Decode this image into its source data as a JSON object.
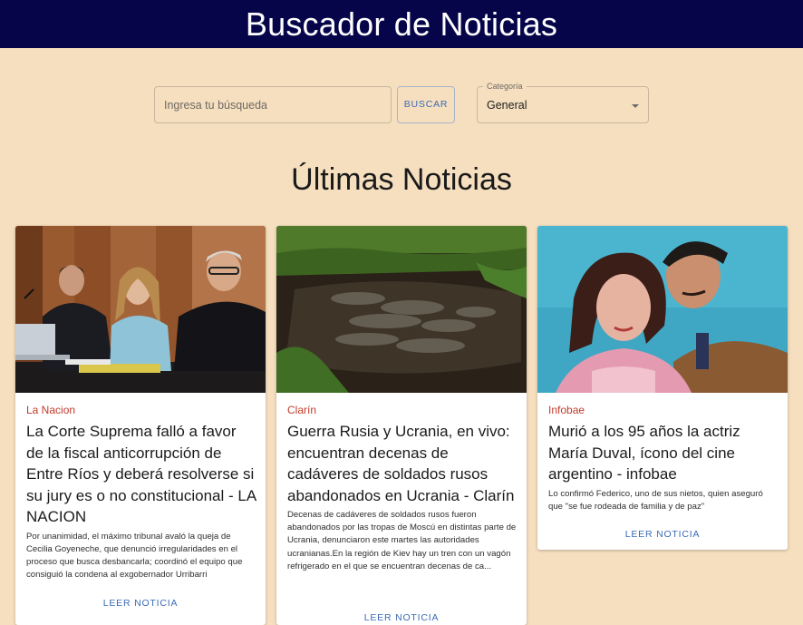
{
  "header": {
    "title": "Buscador de Noticias"
  },
  "search": {
    "placeholder": "Ingresa tu búsqueda",
    "value": "",
    "button_label": "BUSCAR"
  },
  "category": {
    "label": "Categoría",
    "selected": "General"
  },
  "section": {
    "title": "Últimas Noticias"
  },
  "cards": [
    {
      "source": "La Nacion",
      "title": "La Corte Suprema falló a favor de la fiscal anticorrupción de Entre Ríos y deberá resolverse si su jury es o no constitucional - LA NACION",
      "description": "Por unanimidad, el máximo tribunal avaló la queja de Cecilia Goyeneche, que denunció irregularidades en el proceso que busca desbancarla; coordinó el equipo que consiguió la condena al exgobernador Urribarri",
      "action_label": "LEER NOTICIA"
    },
    {
      "source": "Clarín",
      "title": "Guerra Rusia y Ucrania, en vivo: encuentran decenas de cadáveres de soldados rusos abandonados en Ucrania - Clarín",
      "description": "Decenas de cadáveres de soldados rusos fueron abandonados por las tropas de Moscú en distintas parte de Ucrania, denunciaron este martes las autoridades ucranianas.En la región de Kiev hay un tren con un vagón refrigerado en el que se encuentran decenas de ca...",
      "action_label": "LEER NOTICIA"
    },
    {
      "source": "Infobae",
      "title": "Murió a los 95 años la actriz María Duval, ícono del cine argentino - infobae",
      "description": "Lo confirmó Federico, uno de sus nietos, quien aseguró que \"se fue rodeada de familia y de paz\"",
      "action_label": "LEER NOTICIA"
    }
  ],
  "colors": {
    "header_bg": "#07054a",
    "page_bg": "#f5dfbf",
    "source_red": "#c23a2b",
    "action_blue": "#3a6bb5"
  }
}
